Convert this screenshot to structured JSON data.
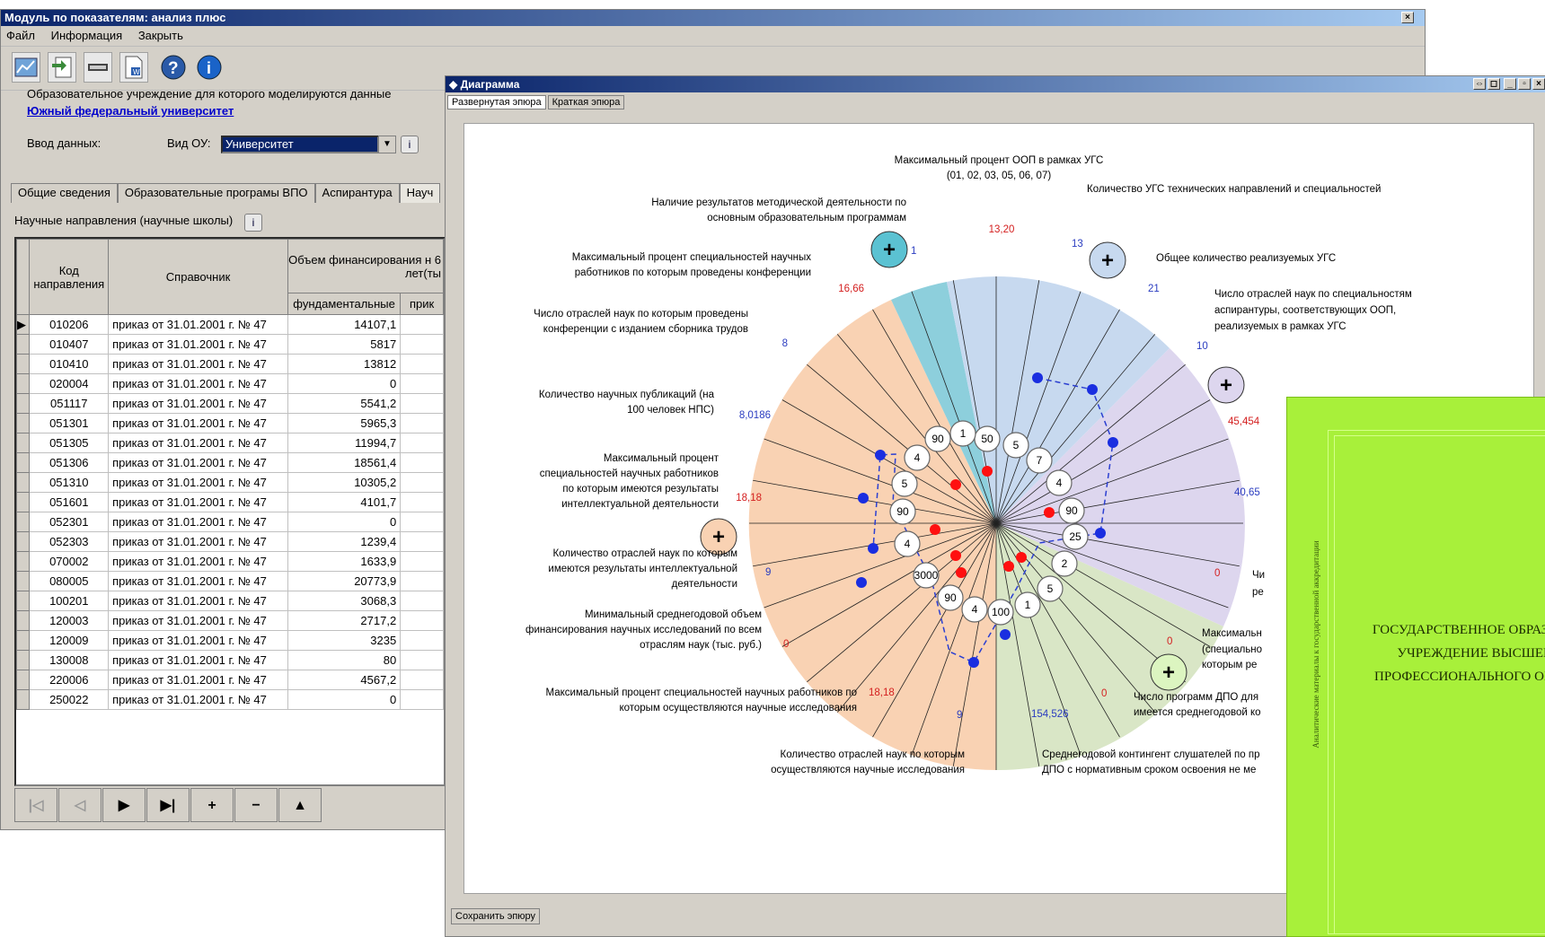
{
  "main_window": {
    "title": "Модуль по показателям: анализ плюс",
    "close_glyph": "×",
    "menu": [
      "Файл",
      "Информация",
      "Закрыть"
    ],
    "toolbar_icons": [
      "chart-icon",
      "import-icon",
      "minus-icon",
      "word-doc-icon",
      "help-icon",
      "info-icon"
    ],
    "org_label": "Образовательное учреждение для которого моделируются данные",
    "org_name": "Южный федеральный университет",
    "input_label": "Ввод данных:",
    "type_label": "Вид ОУ:",
    "type_value": "Университет",
    "tabs": [
      "Общие сведения",
      "Образовательные програмы ВПО",
      "Аспирантура",
      "Науч"
    ],
    "section_title": "Научные направления (научные школы)",
    "grid": {
      "headers": {
        "code": "Код направления",
        "ref": "Справочник",
        "volume": "Объем финансирования н 6 лет(ты",
        "fund": "фундаментальные",
        "applied": "прик"
      },
      "rows": [
        {
          "code": "010206",
          "ref": "приказ от 31.01.2001 г. № 47",
          "fund": "14107,1"
        },
        {
          "code": "010407",
          "ref": "приказ от 31.01.2001 г. № 47",
          "fund": "5817"
        },
        {
          "code": "010410",
          "ref": "приказ от 31.01.2001 г. № 47",
          "fund": "13812"
        },
        {
          "code": "020004",
          "ref": "приказ от 31.01.2001 г. № 47",
          "fund": "0"
        },
        {
          "code": "051117",
          "ref": "приказ от 31.01.2001 г. № 47",
          "fund": "5541,2"
        },
        {
          "code": "051301",
          "ref": "приказ от 31.01.2001 г. № 47",
          "fund": "5965,3"
        },
        {
          "code": "051305",
          "ref": "приказ от 31.01.2001 г. № 47",
          "fund": "11994,7"
        },
        {
          "code": "051306",
          "ref": "приказ от 31.01.2001 г. № 47",
          "fund": "18561,4"
        },
        {
          "code": "051310",
          "ref": "приказ от 31.01.2001 г. № 47",
          "fund": "10305,2"
        },
        {
          "code": "051601",
          "ref": "приказ от 31.01.2001 г. № 47",
          "fund": "4101,7"
        },
        {
          "code": "052301",
          "ref": "приказ от 31.01.2001 г. № 47",
          "fund": "0"
        },
        {
          "code": "052303",
          "ref": "приказ от 31.01.2001 г. № 47",
          "fund": "1239,4"
        },
        {
          "code": "070002",
          "ref": "приказ от 31.01.2001 г. № 47",
          "fund": "1633,9"
        },
        {
          "code": "080005",
          "ref": "приказ от 31.01.2001 г. № 47",
          "fund": "20773,9"
        },
        {
          "code": "100201",
          "ref": "приказ от 31.01.2001 г. № 47",
          "fund": "3068,3"
        },
        {
          "code": "120003",
          "ref": "приказ от 31.01.2001 г. № 47",
          "fund": "2717,2"
        },
        {
          "code": "120009",
          "ref": "приказ от 31.01.2001 г. № 47",
          "fund": "3235"
        },
        {
          "code": "130008",
          "ref": "приказ от 31.01.2001 г. № 47",
          "fund": "80"
        },
        {
          "code": "220006",
          "ref": "приказ от 31.01.2001 г. № 47",
          "fund": "4567,2"
        },
        {
          "code": "250022",
          "ref": "приказ от 31.01.2001 г. № 47",
          "fund": "0"
        }
      ]
    },
    "nav_buttons": [
      "|◁",
      "◁",
      "▶",
      "▶|",
      "+",
      "−",
      "▲"
    ]
  },
  "diagram_window": {
    "title": "Диаграмма",
    "window_buttons": [
      "⇔",
      "◻",
      "_",
      "▫",
      "×"
    ],
    "tabs": [
      "Развернутая эпюра",
      "Краткая эпюра"
    ],
    "save_button": "Сохранить эпюру",
    "plus_glyph": "+",
    "labels": [
      "Максимальный процент ООП в рамках УГС",
      "(01, 02, 03, 05, 06, 07)",
      "Количество УГС технических направлений и специальностей",
      "Наличие результатов методической деятельности по",
      "основным образовательным программам",
      "Общее количество реализуемых УГС",
      "Максимальный процент специальностей научных",
      "работников по которым проведены конференции",
      "Число отраслей наук по специальностям",
      "аспирантуры, соответствующих ООП,",
      "реализуемых в рамках УГС",
      "Число отраслей наук по которым проведены",
      "конференции с изданием сборника трудов",
      "Количество научных публикаций (на",
      "100 человек НПС)",
      "Максимальный процент",
      "специальностей научных работников",
      "по которым имеются результаты",
      "интеллектуальной деятельности",
      "Количество отраслей наук по которым",
      "имеются результаты интеллектуальной",
      "деятельности",
      "Минимальный среднегодовой объем",
      "финансирования научных исследований по всем",
      "отраслям наук (тыс. руб.)",
      "Максимальный процент специальностей научных работников по",
      "которым осуществляются научные исследования",
      "Количество отраслей наук по которым",
      "осуществляются научные исследования",
      "Среднегодовой контингент слушателей по пр",
      "ДПО с нормативным сроком освоения не ме",
      "Число программ ДПО для",
      "имеется среднегодовой ко",
      "Максимальн",
      "(специально",
      "которым ре",
      "Чи",
      "ре"
    ],
    "axis_values": [
      "13,20",
      "13",
      "21",
      "10",
      "45,454",
      "40,65",
      "0",
      "0",
      "0",
      "154,526",
      "9",
      "18,18",
      "0",
      "9",
      "18,18",
      "8,0186",
      "8",
      "16,66",
      "1"
    ],
    "node_values": [
      "50",
      "5",
      "7",
      "4",
      "90",
      "25",
      "2",
      "5",
      "1",
      "100",
      "4",
      "90",
      "3000",
      "4",
      "90",
      "5",
      "4",
      "90",
      "1"
    ]
  },
  "book": {
    "side_text": "Аналитические материалы к государственной аккредитации",
    "title_lines": [
      "ГОСУДАРСТВЕННОЕ ОБРАЗОВА",
      "УЧРЕЖДЕНИЕ ВЫСШЕГ",
      "ПРОФЕССИОНАЛЬНОГО ОБРАЗ"
    ]
  }
}
